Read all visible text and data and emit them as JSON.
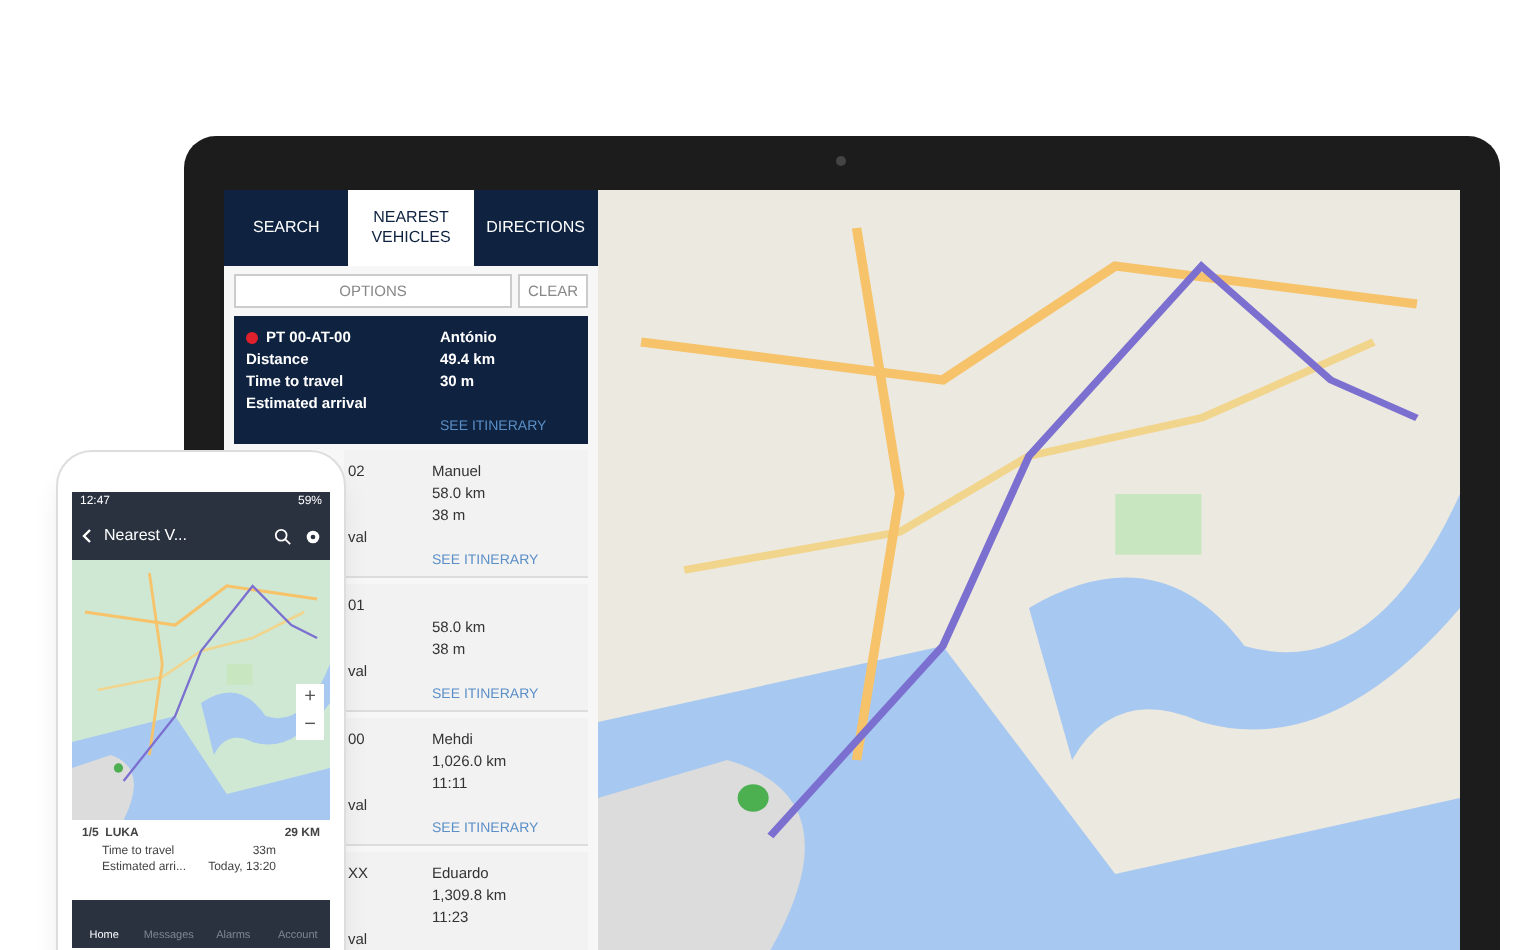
{
  "sidebar": {
    "tabs": [
      {
        "label": "SEARCH",
        "selected": false
      },
      {
        "label": "NEAREST VEHICLES",
        "selected": true
      },
      {
        "label": "DIRECTIONS",
        "selected": false
      }
    ],
    "buttons": [
      "OPTIONS",
      "CLEAR"
    ],
    "vehicles": [
      {
        "selected": true,
        "color": "#e0202c",
        "plate": "PT 00-AT-00",
        "driver": "António",
        "distance_label": "Distance",
        "time_label": "Time to travel",
        "arrival_label": "Estimated arrival",
        "distance": "49.4 km",
        "time": "30 m",
        "link": "SEE ITINERARY"
      },
      {
        "selected": false,
        "plate": "02",
        "driver": "Manuel",
        "arrival_label": "val",
        "distance": "58.0 km",
        "time": "38 m",
        "link": "SEE ITINERARY"
      },
      {
        "selected": false,
        "plate": "01",
        "arrival_label": "val",
        "distance": "58.0 km",
        "time": "38 m",
        "link": "SEE ITINERARY"
      },
      {
        "selected": false,
        "plate": "00",
        "driver": "Mehdi",
        "arrival_label": "val",
        "distance": "1,026.0 km",
        "time": "11:11",
        "link": "SEE ITINERARY"
      },
      {
        "selected": false,
        "plate": "XX",
        "driver": "Eduardo",
        "arrival_label": "val",
        "distance": "1,309.8 km",
        "time": "11:23"
      }
    ]
  },
  "phone": {
    "time": "12:47",
    "battery": "59%",
    "title": "Nearest V...",
    "zoom_buttons": [
      "+",
      "−"
    ],
    "card": {
      "title": "1/5  LUKA",
      "distance": "29 KM",
      "rows": [
        {
          "label": "Time to travel",
          "value": "33m"
        },
        {
          "label": "Estimated arri...",
          "value": "Today, 13:20"
        }
      ]
    },
    "nav": [
      {
        "label": "Home",
        "selected": true
      },
      {
        "label": "Messages",
        "selected": false
      },
      {
        "label": "Alarms",
        "selected": false
      },
      {
        "label": "Account",
        "selected": false
      }
    ]
  }
}
